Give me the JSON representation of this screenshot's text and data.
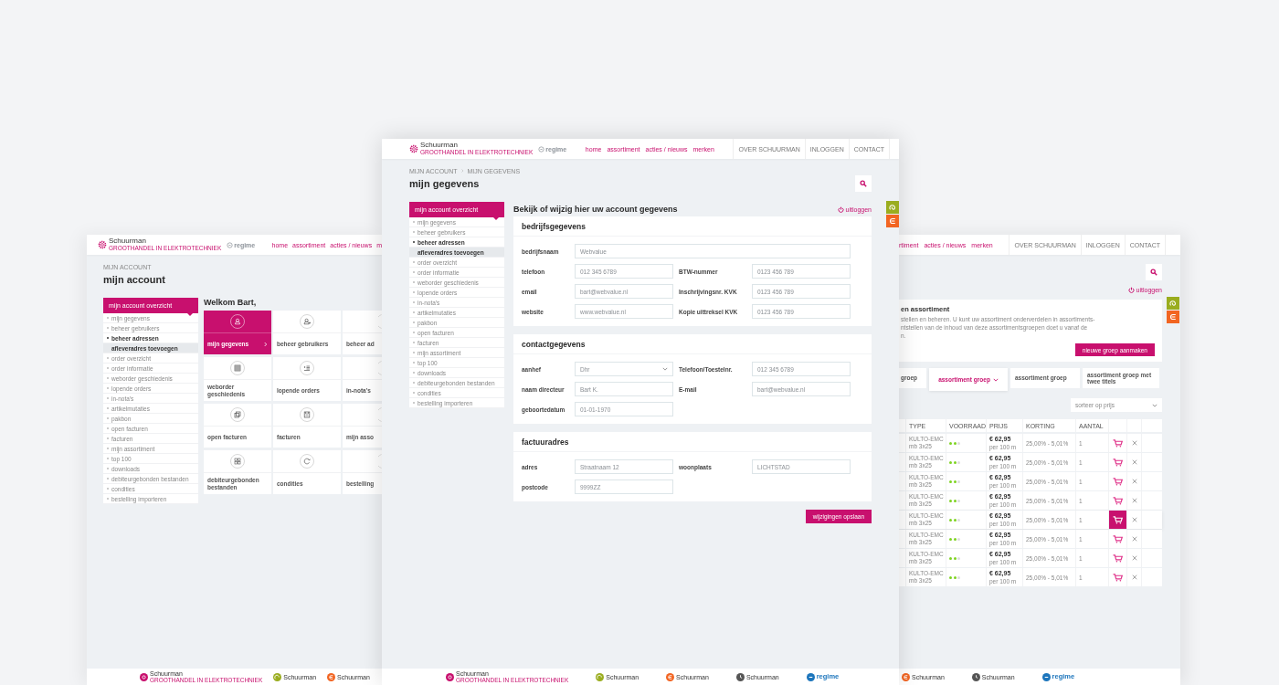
{
  "left_page": {
    "header": {
      "brand": "Schuurman",
      "tagline": "GROOTHANDEL IN ELEKTROTECHNIEK",
      "partner": "regime",
      "nav": [
        "home",
        "assortiment",
        "acties / nieuws",
        "m"
      ]
    },
    "breadcrumb": [
      "MIJN ACCOUNT"
    ],
    "title": "mijn account",
    "sidebar": {
      "heading": "mijn account overzicht",
      "items": [
        {
          "label": "mijn gegevens",
          "selected": false,
          "expanded": false
        },
        {
          "label": "beheer gebruikers",
          "selected": false,
          "expanded": false
        },
        {
          "label": "beheer adressen",
          "selected": false,
          "expanded": true,
          "children": [
            {
              "label": "afleveradres toevoegen",
              "selected": true
            }
          ]
        },
        {
          "label": "order overzicht",
          "selected": false,
          "expanded": false
        },
        {
          "label": "order informatie",
          "selected": false,
          "expanded": false
        },
        {
          "label": "weborder geschiedenis",
          "selected": false,
          "expanded": false
        },
        {
          "label": "lopende orders",
          "selected": false,
          "expanded": false
        },
        {
          "label": "in-nota's",
          "selected": false,
          "expanded": false
        },
        {
          "label": "artikelmutaties",
          "selected": false,
          "expanded": false
        },
        {
          "label": "pakbon",
          "selected": false,
          "expanded": false
        },
        {
          "label": "open facturen",
          "selected": false,
          "expanded": false
        },
        {
          "label": "facturen",
          "selected": false,
          "expanded": false
        },
        {
          "label": "mijn assortiment",
          "selected": false,
          "expanded": false
        },
        {
          "label": "top 100",
          "selected": false,
          "expanded": false
        },
        {
          "label": "downloads",
          "selected": false,
          "expanded": false
        },
        {
          "label": "debiteurgebonden bestanden",
          "selected": false,
          "expanded": false
        },
        {
          "label": "condities",
          "selected": false,
          "expanded": false
        },
        {
          "label": "bestelling importeren",
          "selected": false,
          "expanded": false
        }
      ]
    },
    "welcome": "Welkom Bart,",
    "tiles": [
      {
        "label": "mijn gegevens",
        "selected": true
      },
      {
        "label": "beheer gebruikers",
        "selected": false
      },
      {
        "label": "beheer ad",
        "selected": false
      },
      {
        "label": "weborder geschiedenis",
        "selected": false
      },
      {
        "label": "lopende orders",
        "selected": false
      },
      {
        "label": "in-nota's",
        "selected": false
      },
      {
        "label": "open facturen",
        "selected": false
      },
      {
        "label": "facturen",
        "selected": false
      },
      {
        "label": "mijn asso",
        "selected": false
      },
      {
        "label": "debiteurgebonden bestanden",
        "selected": false
      },
      {
        "label": "condities",
        "selected": false
      },
      {
        "label": "bestelling",
        "selected": false
      }
    ],
    "footer_logos": [
      {
        "kind": "gear",
        "name": "Schuurman",
        "tagline": "GROOTHANDEL IN ELEKTROTECHNIEK",
        "color": "#c8106e"
      },
      {
        "kind": "swirl",
        "name": "Schuurman",
        "color": "#9aad1f"
      },
      {
        "kind": "e",
        "name": "Schuurman",
        "color": "#f26522"
      }
    ]
  },
  "center_page": {
    "header": {
      "brand": "Schuurman",
      "tagline": "GROOTHANDEL IN ELEKTROTECHNIEK",
      "partner": "regime",
      "nav": [
        "home",
        "assortiment",
        "acties / nieuws",
        "merken"
      ],
      "links": [
        "OVER SCHUURMAN",
        "INLOGGEN",
        "CONTACT"
      ]
    },
    "breadcrumb": [
      "MIJN ACCOUNT",
      "MIJN GEGEVENS"
    ],
    "title": "mijn gegevens",
    "sidebar": {
      "heading": "mijn account overzicht",
      "items": [
        {
          "label": "mijn gegevens",
          "selected": false,
          "expanded": false
        },
        {
          "label": "beheer gebruikers",
          "selected": false,
          "expanded": false
        },
        {
          "label": "beheer adressen",
          "selected": false,
          "expanded": true,
          "children": [
            {
              "label": "afleveradres toevoegen",
              "selected": true
            }
          ]
        },
        {
          "label": "order overzicht",
          "selected": false,
          "expanded": false
        },
        {
          "label": "order informatie",
          "selected": false,
          "expanded": false
        },
        {
          "label": "weborder geschiedenis",
          "selected": false,
          "expanded": false
        },
        {
          "label": "lopende orders",
          "selected": false,
          "expanded": false
        },
        {
          "label": "in-nota's",
          "selected": false,
          "expanded": false
        },
        {
          "label": "artikelmutaties",
          "selected": false,
          "expanded": false
        },
        {
          "label": "pakbon",
          "selected": false,
          "expanded": false
        },
        {
          "label": "open facturen",
          "selected": false,
          "expanded": false
        },
        {
          "label": "facturen",
          "selected": false,
          "expanded": false
        },
        {
          "label": "mijn assortiment",
          "selected": false,
          "expanded": false
        },
        {
          "label": "top 100",
          "selected": false,
          "expanded": false
        },
        {
          "label": "downloads",
          "selected": false,
          "expanded": false
        },
        {
          "label": "debiteurgebonden bestanden",
          "selected": false,
          "expanded": false
        },
        {
          "label": "condities",
          "selected": false,
          "expanded": false
        },
        {
          "label": "bestelling importeren",
          "selected": false,
          "expanded": false
        }
      ]
    },
    "heading": "Bekijk of wijzig hier uw account gegevens",
    "logout": "uitloggen",
    "sections": [
      {
        "title": "bedrijfsgegevens",
        "rows": [
          [
            {
              "label": "bedrijfsnaam",
              "value": "Webvalue",
              "kind": "wide"
            }
          ],
          [
            {
              "label": "telefoon",
              "value": "012 345 6789",
              "kind": "text"
            },
            {
              "label": "BTW-nummer",
              "value": "0123 456 789",
              "kind": "text"
            }
          ],
          [
            {
              "label": "email",
              "value": "bart@webvalue.nl",
              "kind": "text"
            },
            {
              "label": "Inschrijvingsnr. KVK",
              "value": "0123 456 789",
              "kind": "text"
            }
          ],
          [
            {
              "label": "website",
              "value": "www.webvalue.nl",
              "kind": "text"
            },
            {
              "label": "Kopie uittreksel KVK",
              "value": "0123 456 789",
              "kind": "text"
            }
          ]
        ]
      },
      {
        "title": "contactgegevens",
        "rows": [
          [
            {
              "label": "aanhef",
              "value": "Dhr",
              "kind": "select"
            },
            {
              "label": "Telefoon/Toestelnr.",
              "value": "012 345 6789",
              "kind": "text"
            }
          ],
          [
            {
              "label": "naam directeur",
              "value": "Bart K.",
              "kind": "text"
            },
            {
              "label": "E-mail",
              "value": "bart@webvalue.nl",
              "kind": "text"
            }
          ],
          [
            {
              "label": "geboortedatum",
              "value": "01-01-1970",
              "kind": "text"
            }
          ]
        ]
      },
      {
        "title": "factuuradres",
        "rows": [
          [
            {
              "label": "adres",
              "value": "Straatnaam 12",
              "kind": "text"
            },
            {
              "label": "woonplaats",
              "value": "LICHTSTAD",
              "kind": "text"
            }
          ],
          [
            {
              "label": "postcode",
              "value": "9999ZZ",
              "kind": "text"
            }
          ]
        ]
      }
    ],
    "save_button": "wijzigingen opslaan",
    "footer_logos": [
      {
        "kind": "gear",
        "name": "Schuurman",
        "tagline": "GROOTHANDEL IN ELEKTROTECHNIEK",
        "color": "#c8106e"
      },
      {
        "kind": "swirl",
        "name": "Schuurman",
        "color": "#9aad1f"
      },
      {
        "kind": "e",
        "name": "Schuurman",
        "color": "#f26522"
      },
      {
        "kind": "clock",
        "name": "Schuurman",
        "color": "#555555"
      },
      {
        "kind": "regime",
        "name": "regime",
        "color": "#1c75bc"
      }
    ]
  },
  "right_page": {
    "header": {
      "nav": [
        "rtiment",
        "acties / nieuws",
        "merken"
      ],
      "links": [
        "OVER SCHUURMAN",
        "INLOGGEN",
        "CONTACT"
      ]
    },
    "logout": "uitloggen",
    "intro": {
      "title": "en assortiment",
      "lines": [
        "stellen en beheren. U kunt uw assortiment onderverdelen in assortiments-",
        "ntstellen van de inhoud van deze assortimentsgroepen doet u vanaf de",
        "n."
      ],
      "button": "nieuwe groep aanmaken"
    },
    "tabs": [
      {
        "label": "groep",
        "selected": false
      },
      {
        "label": "assortiment groep",
        "selected": true
      },
      {
        "label": "assortiment groep",
        "selected": false
      },
      {
        "label": "assortiment groep met twee titels",
        "selected": false
      }
    ],
    "sort": {
      "value": "sorteer op prijs"
    },
    "table": {
      "columns": [
        "TYPE",
        "VOORRAAD",
        "PRIJS",
        "KORTING",
        "AANTAL"
      ],
      "rows": [
        {
          "type": "KULTO-EMC",
          "size": "mb 3x25",
          "stars": 2,
          "price": "€ 62,95",
          "unit": "per 100 m",
          "discount": "25,00% - 5,01%",
          "quantity": "1",
          "selected": false
        },
        {
          "type": "KULTO-EMC",
          "size": "mb 3x25",
          "stars": 2,
          "price": "€ 62,95",
          "unit": "per 100 m",
          "discount": "25,00% - 5,01%",
          "quantity": "1",
          "selected": false
        },
        {
          "type": "KULTO-EMC",
          "size": "mb 3x25",
          "stars": 2,
          "price": "€ 62,95",
          "unit": "per 100 m",
          "discount": "25,00% - 5,01%",
          "quantity": "1",
          "selected": false
        },
        {
          "type": "KULTO-EMC",
          "size": "mb 3x25",
          "stars": 2,
          "price": "€ 62,95",
          "unit": "per 100 m",
          "discount": "25,00% - 5,01%",
          "quantity": "1",
          "selected": false
        },
        {
          "type": "KULTO-EMC",
          "size": "mb 3x25",
          "stars": 2,
          "price": "€ 62,95",
          "unit": "per 100 m",
          "discount": "25,00% - 5,01%",
          "quantity": "1",
          "selected": true
        },
        {
          "type": "KULTO-EMC",
          "size": "mb 3x25",
          "stars": 2,
          "price": "€ 62,95",
          "unit": "per 100 m",
          "discount": "25,00% - 5,01%",
          "quantity": "1",
          "selected": false
        },
        {
          "type": "KULTO-EMC",
          "size": "mb 3x25",
          "stars": 2,
          "price": "€ 62,95",
          "unit": "per 100 m",
          "discount": "25,00% - 5,01%",
          "quantity": "1",
          "selected": false
        },
        {
          "type": "KULTO-EMC",
          "size": "mb 3x25",
          "stars": 2,
          "price": "€ 62,95",
          "unit": "per 100 m",
          "discount": "25,00% - 5,01%",
          "quantity": "1",
          "selected": false
        }
      ]
    },
    "footer_logos": [
      {
        "kind": "e",
        "name": "Schuurman",
        "color": "#f26522"
      },
      {
        "kind": "clock",
        "name": "Schuurman",
        "color": "#555555"
      },
      {
        "kind": "regime",
        "name": "regime",
        "color": "#1c75bc"
      }
    ]
  }
}
